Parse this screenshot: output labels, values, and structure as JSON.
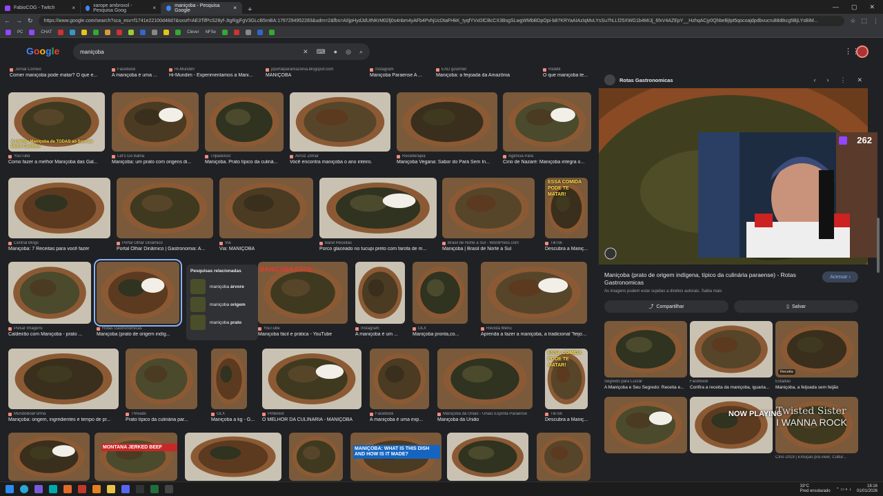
{
  "browser": {
    "tabs": [
      {
        "title": "FabioCOG - Twitch",
        "color": "#9146ff"
      },
      {
        "title": "xarope ambroxol - Pesquisa Goog",
        "color": "#4285f4"
      },
      {
        "title": "maniçoba - Pesquisa Google",
        "color": "#4285f4",
        "active": true
      }
    ],
    "url": "https://www.google.com/search?sca_esv=f1741e22100d48d7&sxsrf=AE3TifPcS28yf-JtgRgjFgV3GLcB5mBA:1767294952283&udm=2&fbs=AIIjpHydJdUtNKrM02lj0s4nbm4yAFb4PvhjUcDtaFHkK_tyqfYVxDlCBcCX3BsgSLwgWMbBDpOpi-b87KRYaAIAzIqMvLYsSu7hLLf25XWG1b4MIJj_6fxV4AZEpY__HzhqACjy0QhbeBjtpt5qocoajdpdbvucru88dtkcg5BjLYsBiM..."
  },
  "google": {
    "logo": "Google",
    "query": "maniçoba",
    "related_title": "Pesquisas relacionadas",
    "related": [
      {
        "word": "maniçoba",
        "bold": "árvore"
      },
      {
        "word": "maniçoba",
        "bold": "origem"
      },
      {
        "word": "maniçoba",
        "bold": "prato"
      }
    ]
  },
  "results": [
    {
      "src": "Jornal Correio",
      "title": "Comer maniçoba pode matar? O que e..."
    },
    {
      "src": "Facebook",
      "title": "A maniçoba é uma ..."
    },
    {
      "src": "Hi-Mundim",
      "title": "Hi-Mundim - Experimentamos a Mani..."
    },
    {
      "src": "pportalparamazonia.blogspot.com",
      "title": "MANIÇOBA"
    },
    {
      "src": "Instagram",
      "title": "Maniçoba Paraense A ..."
    },
    {
      "src": "EAD gourmet",
      "title": "Maniçoba: a feijoada da Amazônia"
    },
    {
      "src": "Reddit",
      "title": "O que maniçoba te..."
    },
    {
      "src": "YouTube",
      "title": "Como fazer a melhor Maniçoba das Gal..."
    },
    {
      "src": "Let's Go Bahia",
      "title": "Maniçoba: um prato com origens di..."
    },
    {
      "src": "Tripadvisor",
      "title": "Maniçoba. Prato típico da culiná..."
    },
    {
      "src": "Airroz Zilmar",
      "title": "Você encontra maniçoba o ano inteiro."
    },
    {
      "src": "Receiterapia",
      "title": "Maniçoba Vegana: Sabor do Pará Sem In..."
    },
    {
      "src": "Agência Pará",
      "title": "Círio de Nazaré: Maniçoba integra o..."
    },
    {
      "src": "Central Blogs",
      "title": "Maniçoba: 7 Receitas para você fazer"
    },
    {
      "src": "Portal Olhar Dinâmico",
      "title": "Portal Olhar Dinâmico | Gastronomia: A..."
    },
    {
      "src": "Via",
      "title": "Via: MANIÇOBA"
    },
    {
      "src": "Band Receitas",
      "title": "Porco glaceado no tucupi preto com farofa de m..."
    },
    {
      "src": "Brasil de Norte a Sul - WordPress.com",
      "title": "Maniçoba | Brasil de Norte a Sul"
    },
    {
      "src": "TikTok",
      "title": "Descubra a Maniç..."
    },
    {
      "src": "Pulsar Imagens",
      "title": "Caldeirão com Maniçoba - prato ..."
    },
    {
      "src": "Rotas Gastronomicas",
      "title": "Maniçoba (prato de origem indíg..."
    },
    {
      "src": "YouTube",
      "title": "Maniçoba fácil e prática - YouTube"
    },
    {
      "src": "Instagram",
      "title": "A maniçoba é um ..."
    },
    {
      "src": "OLX",
      "title": "Maniçoba pronta,co..."
    },
    {
      "src": "Revista Menu",
      "title": "Aprenda a fazer a maniçoba, a tradicional \"feijoa..."
    },
    {
      "src": "MundoBoaForma",
      "title": "Maniçoba: origem, ingredientes e tempo de pr..."
    },
    {
      "src": "Threads",
      "title": "Prato típico da culinária par..."
    },
    {
      "src": "OLX",
      "title": "Maniçoba a kg - G..."
    },
    {
      "src": "Pinterest",
      "title": "O MELHOR DA CULINÁRIA - MANIÇOBA"
    },
    {
      "src": "Facebook",
      "title": "A maniçoba é uma exp..."
    },
    {
      "src": "Maniçoba da União - União Espírita Paraense",
      "title": "Maniçoba da União"
    },
    {
      "src": "TikTok",
      "title": "Descubra a Maniç..."
    }
  ],
  "image_texts": {
    "yt": "A melhor Maniçoba de TODAS ao Som de Muito Carimbó",
    "facil": "MANIÇOBA FÁCIL",
    "essa": "ESSA COMIDA PODE TE MATAR!",
    "jerky": "MONTANA JERKED BEEF",
    "what": "MANIÇOBA: WHAT IS THIS DISH AND HOW IS IT MADE?",
    "manicoba_brand": "Maniçoba"
  },
  "panel": {
    "source": "Rotas Gastronomicas",
    "title": "Maniçoba (prato de origem indígena, típico da culinária paraense) - Rotas Gastronomicas",
    "access": "Acessar",
    "note": "As imagens podem estar sujeitas a direitos autorais. Saiba mais",
    "share": "Compartilhar",
    "save": "Salvar",
    "related": [
      {
        "src": "Segredo para Lucrar",
        "title": "A Maniçoba e Seu Segredo: Receita e..."
      },
      {
        "src": "Facebook",
        "title": "Confira a receita da maniçoba, iguaria..."
      },
      {
        "src": "Estadão",
        "title": "Maniçoba, a feijoada sem feijão",
        "badge": "Receita"
      },
      {
        "src": "",
        "title": ""
      },
      {
        "src": "",
        "title": ""
      },
      {
        "src": "Círio 2019 | Emoção pra viver, Cultur...",
        "title": ""
      }
    ]
  },
  "stream": {
    "viewers": "262",
    "now_playing": "NOW PLAYING",
    "song_artist": "Twisted Sister",
    "song_title": "I WANNA ROCK"
  },
  "taskbar": {
    "weather": "33°C",
    "weather_desc": "Pred ensolarado",
    "time": "18:16",
    "date": "01/01/2026"
  },
  "colors": {
    "dish": "#3b3a1e",
    "pot": "#7a4a2a",
    "accent": "#8ab4f8"
  }
}
